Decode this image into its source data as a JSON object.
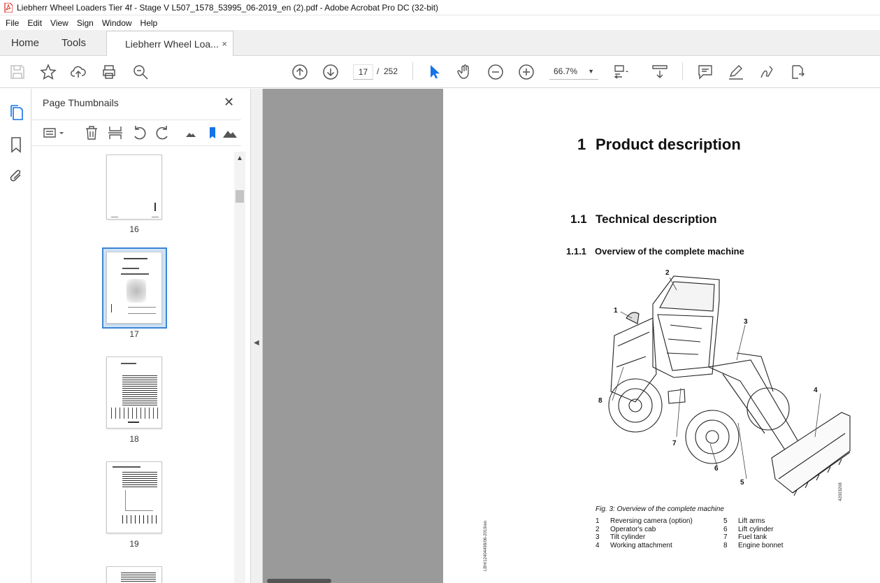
{
  "window": {
    "title": "Liebherr Wheel Loaders Tier 4f - Stage V L507_1578_53995_06-2019_en (2).pdf - Adobe Acrobat Pro DC (32-bit)"
  },
  "menu": [
    "File",
    "Edit",
    "View",
    "Sign",
    "Window",
    "Help"
  ],
  "tabs": {
    "home": "Home",
    "tools": "Tools",
    "document": "Liebherr Wheel Loa...",
    "close": "×"
  },
  "toolbar": {
    "current_page": "17",
    "separator": "/",
    "total_pages": "252",
    "zoom": "66.7%"
  },
  "thumbnails_panel": {
    "title": "Page Thumbnails",
    "close": "✕",
    "pages": [
      {
        "label": "16"
      },
      {
        "label": "17",
        "selected": true
      },
      {
        "label": "18"
      },
      {
        "label": "19"
      }
    ]
  },
  "page": {
    "chapter_num": "1",
    "chapter_title": "Product description",
    "section_num": "1.1",
    "section_title": "Technical description",
    "subsection_num": "1.1.1",
    "subsection_title": "Overview of the complete machine",
    "figure_caption": "Fig. 3: Overview of the complete machine",
    "side_code": "LBH/12404498/06-2019/en",
    "figure_code": "42003208",
    "callouts": [
      "1",
      "2",
      "3",
      "4",
      "5",
      "6",
      "7",
      "8"
    ],
    "legend_left": [
      {
        "n": "1",
        "text": "Reversing camera (option)"
      },
      {
        "n": "2",
        "text": "Operator's cab"
      },
      {
        "n": "3",
        "text": "Tilt cylinder"
      },
      {
        "n": "4",
        "text": "Working attachment"
      }
    ],
    "legend_right": [
      {
        "n": "5",
        "text": "Lift arms"
      },
      {
        "n": "6",
        "text": "Lift cylinder"
      },
      {
        "n": "7",
        "text": "Fuel tank"
      },
      {
        "n": "8",
        "text": "Engine bonnet"
      }
    ]
  },
  "colors": {
    "accent": "#3b85d6",
    "doc_background": "#9a9a9a",
    "select_tool": "#1473e6",
    "pdf_icon": "#d9261c"
  }
}
